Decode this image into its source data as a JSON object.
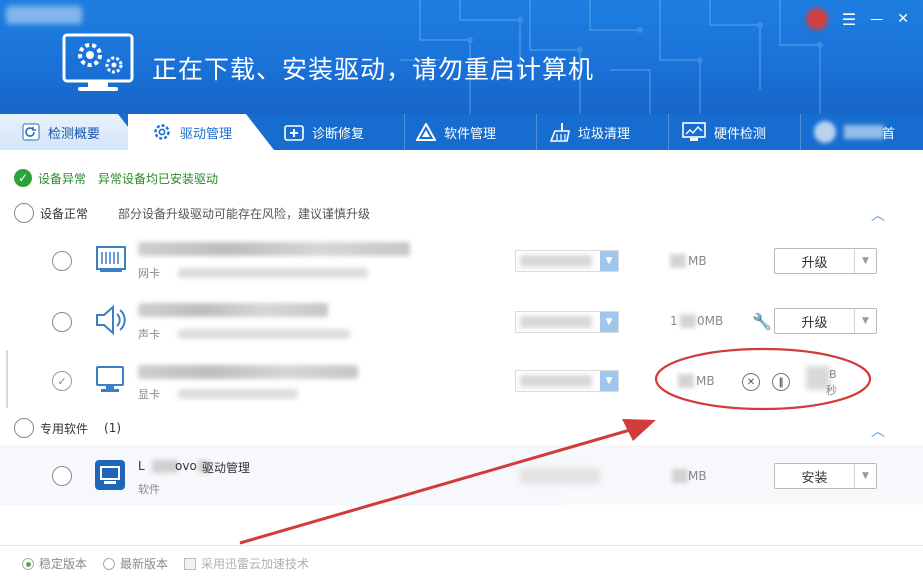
{
  "header": {
    "title": "正在下载、安装驱动，请勿重启计算机",
    "menu_glyph": "☰",
    "minimize_glyph": "—",
    "close_glyph": "✕"
  },
  "tabs": [
    {
      "label": "检测概要",
      "icon": "refresh-icon"
    },
    {
      "label": "驱动管理",
      "icon": "gear-icon"
    },
    {
      "label": "诊断修复",
      "icon": "medkit-icon"
    },
    {
      "label": "软件管理",
      "icon": "triangle-logo-icon"
    },
    {
      "label": "垃圾清理",
      "icon": "broom-icon"
    },
    {
      "label": "硬件检测",
      "icon": "monitor-chart-icon"
    },
    {
      "label": "首",
      "icon": "home-icon"
    }
  ],
  "status": {
    "check_glyph": "✓",
    "label": "设备异常",
    "message": "异常设备均已安装驱动"
  },
  "section_normal": {
    "label": "设备正常",
    "warning": "部分设备升级驱动可能存在风险，建议谨慎升级",
    "caret": "︿"
  },
  "devices": [
    {
      "type": "网卡",
      "size_unit": "MB",
      "action": "升级"
    },
    {
      "type": "声卡",
      "size_prefix": "1",
      "size_unit": "0MB",
      "action": "升级",
      "wrench": "🔧"
    },
    {
      "type": "显卡",
      "size_unit": "MB",
      "progress_unit": "B",
      "seconds": "秒",
      "cancel_glyph": "✕",
      "pause_glyph": "‖"
    }
  ],
  "section_software": {
    "label": "专用软件",
    "count": "(1)",
    "caret": "︿"
  },
  "software": [
    {
      "title_prefix": "L",
      "title_mid": "ovo",
      "title_suffix": "驱动管理",
      "type": "软件",
      "size_unit": "MB",
      "action": "安装"
    }
  ],
  "footer": {
    "stable": "稳定版本",
    "latest": "最新版本",
    "accelerate": "采用迅雷云加速技术"
  },
  "colors": {
    "header_blue": "#1a72d8",
    "tab_blue": "#166dcf",
    "accent_green": "#2aa33b",
    "annotation_red": "#d23b3b"
  }
}
